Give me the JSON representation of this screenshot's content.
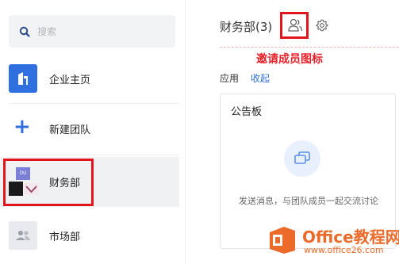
{
  "search": {
    "placeholder": "搜索"
  },
  "sidebar": {
    "items": [
      {
        "label": "企业主页",
        "icon": "enterprise-home-icon"
      },
      {
        "label": "新建团队",
        "icon": "plus-icon"
      },
      {
        "label": "财务部",
        "icon": "team-avatar"
      },
      {
        "label": "市场部",
        "icon": "team-people-icon"
      }
    ],
    "finance_avatar_text": "OU"
  },
  "header": {
    "title": "财务部(3)",
    "annotation": "邀请成员图标"
  },
  "apps": {
    "label": "应用",
    "collapse_label": "收起"
  },
  "board": {
    "title": "公告板",
    "empty_text": "发送消息，与团队成员一起交流讨论"
  },
  "watermark": {
    "name": "Office教程网",
    "url": "www.office26.com"
  },
  "colors": {
    "accent": "#2f6fe0",
    "annotation_red": "#e0151d",
    "watermark_orange": "#ec6a2a"
  }
}
